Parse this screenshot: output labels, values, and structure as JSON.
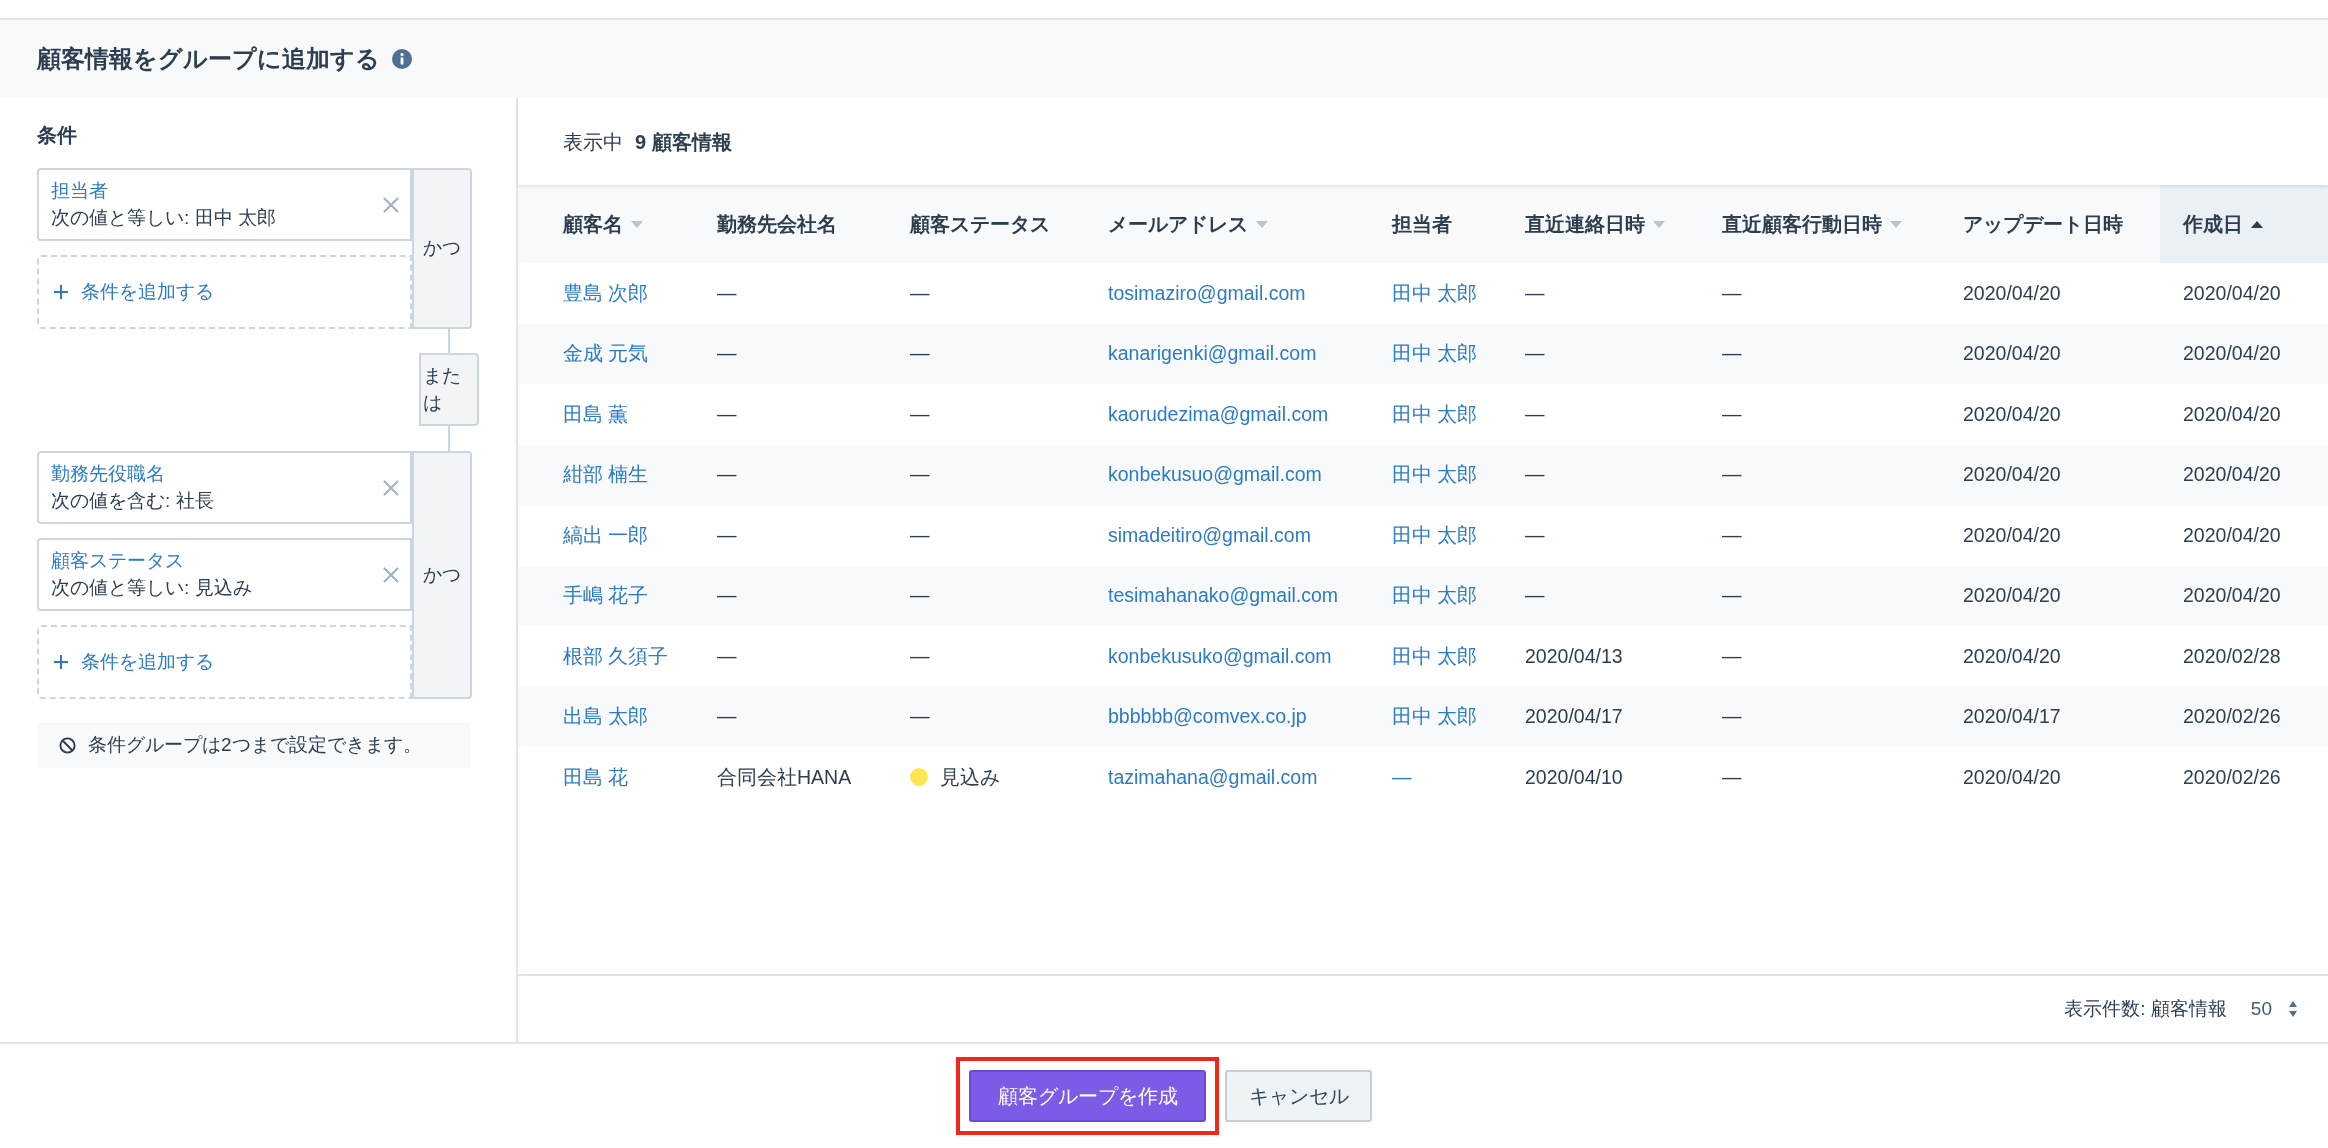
{
  "title": "顧客情報をグループに追加する",
  "conditions": {
    "heading": "条件",
    "groups": [
      {
        "connector": "かつ",
        "items": [
          {
            "field": "担当者",
            "rule": "次の値と等しい: 田中 太郎"
          }
        ],
        "add_label": "条件を追加する"
      },
      {
        "connector": "かつ",
        "items": [
          {
            "field": "勤務先役職名",
            "rule": "次の値を含む: 社長"
          },
          {
            "field": "顧客ステータス",
            "rule": "次の値と等しい: 見込み"
          }
        ],
        "add_label": "条件を追加する"
      }
    ],
    "between": "または",
    "note": "条件グループは2つまで設定できます。"
  },
  "results": {
    "summary_prefix": "表示中",
    "summary_count": "9 顧客情報",
    "columns": [
      {
        "label": "顧客名",
        "kind": "link",
        "sortable": true,
        "selected": false
      },
      {
        "label": "勤務先会社名",
        "kind": "text",
        "sortable": false,
        "selected": false
      },
      {
        "label": "顧客ステータス",
        "kind": "status",
        "sortable": false,
        "selected": false
      },
      {
        "label": "メールアドレス",
        "kind": "link",
        "sortable": true,
        "selected": false
      },
      {
        "label": "担当者",
        "kind": "link",
        "sortable": false,
        "selected": false
      },
      {
        "label": "直近連絡日時",
        "kind": "text",
        "sortable": true,
        "selected": false
      },
      {
        "label": "直近顧客行動日時",
        "kind": "text",
        "sortable": true,
        "selected": false
      },
      {
        "label": "アップデート日時",
        "kind": "text",
        "sortable": false,
        "selected": false
      },
      {
        "label": "作成日",
        "kind": "text",
        "sortable": true,
        "selected": true
      }
    ],
    "rows": [
      [
        "豊島 次郎",
        "—",
        "—",
        "tosimaziro@gmail.com",
        "田中 太郎",
        "—",
        "—",
        "2020/04/20",
        "2020/04/20"
      ],
      [
        "金成 元気",
        "—",
        "—",
        "kanarigenki@gmail.com",
        "田中 太郎",
        "—",
        "—",
        "2020/04/20",
        "2020/04/20"
      ],
      [
        "田島 薫",
        "—",
        "—",
        "kaorudezima@gmail.com",
        "田中 太郎",
        "—",
        "—",
        "2020/04/20",
        "2020/04/20"
      ],
      [
        "紺部 楠生",
        "—",
        "—",
        "konbekusuo@gmail.com",
        "田中 太郎",
        "—",
        "—",
        "2020/04/20",
        "2020/04/20"
      ],
      [
        "縞出 一郎",
        "—",
        "—",
        "simadeitiro@gmail.com",
        "田中 太郎",
        "—",
        "—",
        "2020/04/20",
        "2020/04/20"
      ],
      [
        "手嶋 花子",
        "—",
        "—",
        "tesimahanako@gmail.com",
        "田中 太郎",
        "—",
        "—",
        "2020/04/20",
        "2020/04/20"
      ],
      [
        "根部 久須子",
        "—",
        "—",
        "konbekusuko@gmail.com",
        "田中 太郎",
        "2020/04/13",
        "—",
        "2020/04/20",
        "2020/02/28"
      ],
      [
        "出島 太郎",
        "—",
        "—",
        "bbbbbb@comvex.co.jp",
        "田中 太郎",
        "2020/04/17",
        "—",
        "2020/04/17",
        "2020/02/26"
      ],
      [
        "田島 花",
        "合同会社HANA",
        {
          "label": "見込み",
          "color": "#fde651"
        },
        "tazimahana@gmail.com",
        "—",
        "2020/04/10",
        "—",
        "2020/04/20",
        "2020/02/26"
      ]
    ],
    "page_size_label": "表示件数: 顧客情報",
    "page_size": "50"
  },
  "buttons": [
    {
      "label": "顧客グループを作成",
      "kind": "primary",
      "highlighted": true
    },
    {
      "label": "キャンセル",
      "kind": "secondary",
      "highlighted": false
    }
  ]
}
